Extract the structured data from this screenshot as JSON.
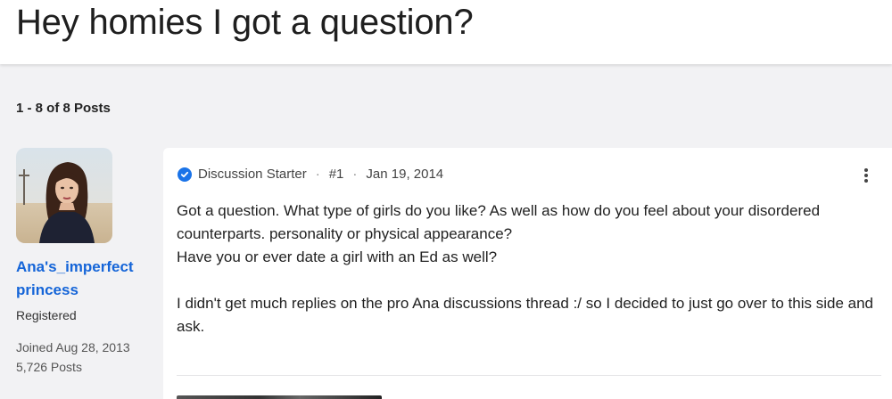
{
  "thread": {
    "title": "Hey homies I got a question?",
    "post_count": "1 - 8 of 8 Posts"
  },
  "author": {
    "name": "Ana's_imperfect princess",
    "role": "Registered",
    "joined": "Joined Aug 28, 2013",
    "posts": "5,726 Posts"
  },
  "post": {
    "badge": "Discussion Starter",
    "number": "#1",
    "date": "Jan 19, 2014",
    "body": [
      "Got a question. What type of girls do you like? As well as how do you feel about your disordered counterparts. personality or physical appearance?",
      "Have you or ever date a girl with an Ed as well?",
      "I didn't get much replies on the pro Ana discussions thread :/ so I decided to just go over to this side and ask."
    ]
  },
  "icons": {
    "verified": "check-circle-icon",
    "more": "vertical-dots-icon"
  },
  "colors": {
    "link": "#1565d8",
    "verified": "#1a73e8",
    "page_bg": "#f2f2f4"
  },
  "separator": "·"
}
